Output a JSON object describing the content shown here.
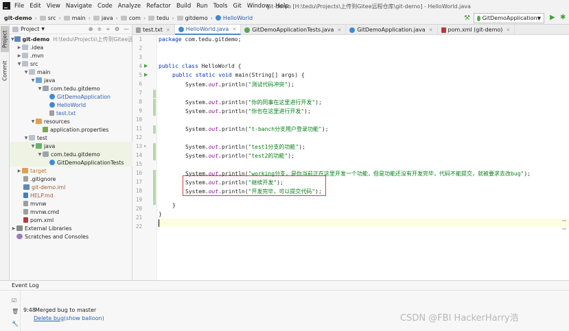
{
  "menubar": {
    "items": [
      "File",
      "Edit",
      "View",
      "Navigate",
      "Code",
      "Analyze",
      "Refactor",
      "Build",
      "Run",
      "Tools",
      "Git",
      "Window",
      "Help"
    ],
    "window_title": "git-demo [H:\\tedu\\Projects\\上传到Gitee远程仓库\\git-demo] - HelloWorld.java"
  },
  "navbar": {
    "crumbs": [
      "git-demo",
      "src",
      "main",
      "java",
      "com",
      "tedu",
      "gitdemo",
      "HelloWorld"
    ],
    "run_config": "GitDemoApplication"
  },
  "side_tabs": {
    "project": "Project",
    "commit": "Commit"
  },
  "project": {
    "header": "Project",
    "tree": [
      {
        "label": "git-demo",
        "path": "H:\\tedu\\Projects\\上传到Gitee远程仓"
      },
      {
        "label": ".idea"
      },
      {
        "label": ".mvn"
      },
      {
        "label": "src"
      },
      {
        "label": "main"
      },
      {
        "label": "java"
      },
      {
        "label": "com.tedu.gitdemo"
      },
      {
        "label": "GitDemoApplication"
      },
      {
        "label": "HelloWorld"
      },
      {
        "label": "test.txt"
      },
      {
        "label": "resources"
      },
      {
        "label": "application.properties"
      },
      {
        "label": "test"
      },
      {
        "label": "java"
      },
      {
        "label": "com.tedu.gitdemo"
      },
      {
        "label": "GitDemoApplicationTests"
      },
      {
        "label": "target"
      },
      {
        "label": ".gitignore"
      },
      {
        "label": "git-demo.iml"
      },
      {
        "label": "HELP.md"
      },
      {
        "label": "mvnw"
      },
      {
        "label": "mvnw.cmd"
      },
      {
        "label": "pom.xml"
      },
      {
        "label": "External Libraries"
      },
      {
        "label": "Scratches and Consoles"
      }
    ]
  },
  "tabs": [
    {
      "label": "test.txt"
    },
    {
      "label": "HelloWorld.java"
    },
    {
      "label": "GitDemoApplicationTests.java"
    },
    {
      "label": "GitDemoApplication.java"
    },
    {
      "label": "pom.xml (git-demo)"
    }
  ],
  "code": {
    "line_numbers": [
      "1",
      "2",
      "3",
      "4",
      "5",
      "6",
      "7",
      "8",
      "9",
      "10",
      "11",
      "12",
      "13",
      "14",
      "15",
      "16",
      "17",
      "18",
      "19",
      "20",
      "21",
      "22"
    ],
    "package_kw": "package",
    "package_name": " com.tedu.gitdemo;",
    "class_decl_kw": "public class",
    "class_decl_rest": " HelloWorld {",
    "main_kw": "public static void",
    "main_rest": " main(String[] args) {",
    "sys": "System.",
    "out": "out",
    "println": ".println(",
    "close": ");",
    "strings": [
      "\"测试代码冲突\"",
      "\"你的同事在这里进行开发\"",
      "\"你也在这里进行开发\"",
      "\"t-banch分支用户登录功能\"",
      "\"test1分支的功能\"",
      "\"test2的功能\"",
      "\"working分支，是你当前正在这里开发一个功能，但是功能还没有开发完毕，代码不能提交，就被要求去改bug\"",
      "\"继续开发\"",
      "\"开发完毕，可以提交代码\""
    ],
    "method_close": "}",
    "class_close": "}"
  },
  "event_log": {
    "title": "Event Log",
    "time": "9:48",
    "message": "Merged bug to master",
    "link1": "Delete bug",
    "link2": "(show balloon)"
  },
  "watermark": "CSDN @FBI HackerHarry浩",
  "colors": {
    "accent": "#4a88c7",
    "keyword": "#0033b3",
    "string": "#067d17",
    "field": "#871094",
    "highlight_box": "#d93a3a"
  }
}
